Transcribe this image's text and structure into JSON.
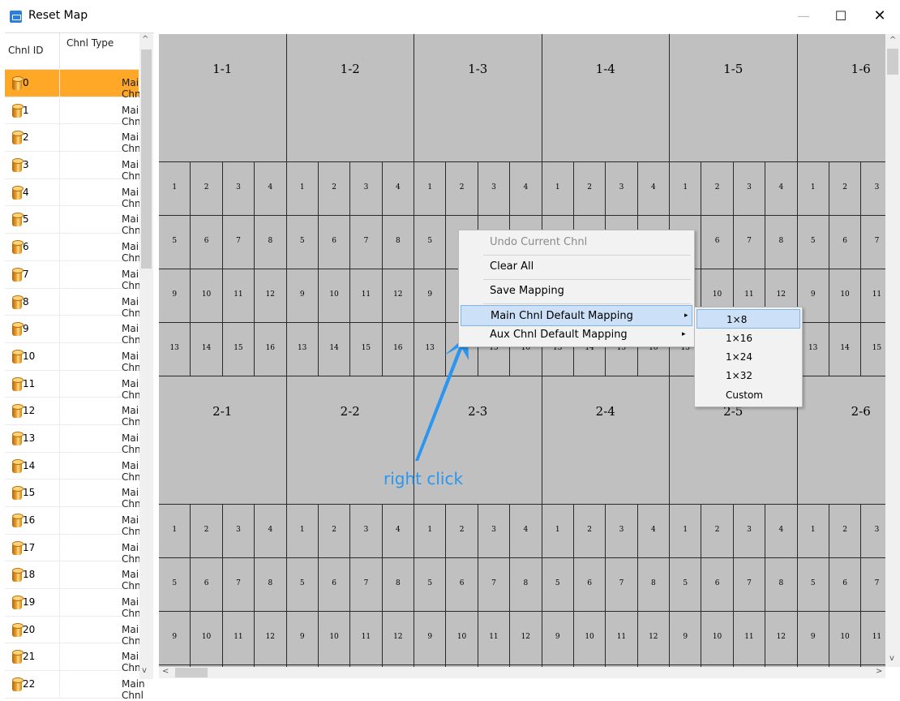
{
  "window": {
    "title": "Reset Map",
    "minimize": "—",
    "maximize": "☐",
    "close": "✕"
  },
  "channel_list": {
    "headers": {
      "id": "Chnl ID",
      "type": "Chnl Type"
    },
    "rows": [
      {
        "id": "0",
        "type": "Main Chnl",
        "selected": true
      },
      {
        "id": "1",
        "type": "Main Chnl"
      },
      {
        "id": "2",
        "type": "Main Chnl"
      },
      {
        "id": "3",
        "type": "Main Chnl"
      },
      {
        "id": "4",
        "type": "Main Chnl"
      },
      {
        "id": "5",
        "type": "Main Chnl"
      },
      {
        "id": "6",
        "type": "Main Chnl"
      },
      {
        "id": "7",
        "type": "Main Chnl"
      },
      {
        "id": "8",
        "type": "Main Chnl"
      },
      {
        "id": "9",
        "type": "Main Chnl"
      },
      {
        "id": "10",
        "type": "Main Chnl"
      },
      {
        "id": "11",
        "type": "Main Chnl"
      },
      {
        "id": "12",
        "type": "Main Chnl"
      },
      {
        "id": "13",
        "type": "Main Chnl"
      },
      {
        "id": "14",
        "type": "Main Chnl"
      },
      {
        "id": "15",
        "type": "Main Chnl"
      },
      {
        "id": "16",
        "type": "Main Chnl"
      },
      {
        "id": "17",
        "type": "Main Chnl"
      },
      {
        "id": "18",
        "type": "Main Chnl"
      },
      {
        "id": "19",
        "type": "Main Chnl"
      },
      {
        "id": "20",
        "type": "Main Chnl"
      },
      {
        "id": "21",
        "type": "Main Chnl"
      },
      {
        "id": "22",
        "type": "Main Chnl"
      }
    ],
    "icon": "channel-cylinder-icon",
    "selected_color": "#ffa726"
  },
  "grid": {
    "screens_row1": [
      "1-1",
      "1-2",
      "1-3",
      "1-4",
      "1-5",
      "1-6"
    ],
    "screens_row2": [
      "2-1",
      "2-2",
      "2-3",
      "2-4",
      "2-5",
      "2-6"
    ],
    "subcells": [
      "1",
      "2",
      "3",
      "4",
      "5",
      "6",
      "7",
      "8",
      "9",
      "10",
      "11",
      "12",
      "13",
      "14",
      "15",
      "16"
    ],
    "background": "#c0c0c0"
  },
  "context_menu": {
    "items": [
      {
        "label": "Undo Current Chnl",
        "disabled": true
      },
      {
        "label": "Clear All"
      },
      {
        "label": "Save Mapping"
      },
      {
        "label": "Main Chnl Default Mapping",
        "submenu": true,
        "highlighted": true
      },
      {
        "label": "Aux Chnl Default Mapping",
        "submenu": true
      }
    ],
    "submenu_arrow": "▸"
  },
  "submenu": {
    "items": [
      {
        "label": "1×8",
        "highlighted": true
      },
      {
        "label": "1×16"
      },
      {
        "label": "1×24"
      },
      {
        "label": "1×32"
      },
      {
        "label": "Custom"
      }
    ]
  },
  "annotation": {
    "text": "right click",
    "color": "#2a96ef"
  }
}
